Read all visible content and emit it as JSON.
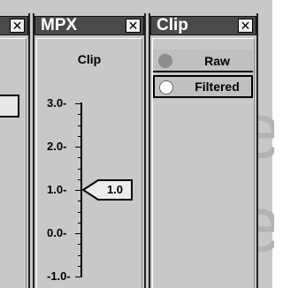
{
  "left_panel": {
    "close_label": "✕"
  },
  "mpx_panel": {
    "title": "MPX",
    "close_label": "✕",
    "meter": {
      "label": "Clip",
      "ticks": [
        {
          "label": "3.0-",
          "value": 3.0
        },
        {
          "label": "2.0-",
          "value": 2.0
        },
        {
          "label": "1.0-",
          "value": 1.0
        },
        {
          "label": "0.0-",
          "value": 0.0
        },
        {
          "label": "-1.0-",
          "value": -1.0
        }
      ],
      "range": [
        -1.0,
        3.0
      ],
      "value": 1.0,
      "value_label": "1.0"
    }
  },
  "clip_panel": {
    "title": "Clip",
    "close_label": "✕",
    "options": [
      {
        "label": "Raw",
        "selected": false
      },
      {
        "label": "Filtered",
        "selected": true
      }
    ]
  },
  "background_text": "ee",
  "colors": {
    "panel_bg": "#c8c8c8",
    "titlebar": "#4a4a4a",
    "title_text": "#ffffff"
  }
}
